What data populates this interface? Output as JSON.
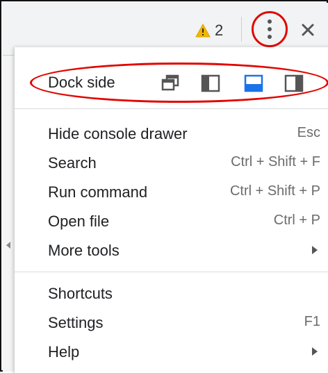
{
  "toolbar": {
    "warning_count": "2",
    "warning_icon": "warning-triangle-icon",
    "more_icon": "kebab-vertical-icon",
    "close_icon": "close-x-icon"
  },
  "dock": {
    "label": "Dock side",
    "options": [
      {
        "name": "undock",
        "icon": "undock-window-icon",
        "selected": false
      },
      {
        "name": "dock-left",
        "icon": "dock-left-icon",
        "selected": false
      },
      {
        "name": "dock-bottom",
        "icon": "dock-bottom-icon",
        "selected": true
      },
      {
        "name": "dock-right",
        "icon": "dock-right-icon",
        "selected": false
      }
    ]
  },
  "menu": {
    "hide_console_drawer": {
      "label": "Hide console drawer",
      "shortcut": "Esc"
    },
    "search": {
      "label": "Search",
      "shortcut": "Ctrl + Shift + F"
    },
    "run_command": {
      "label": "Run command",
      "shortcut": "Ctrl + Shift + P"
    },
    "open_file": {
      "label": "Open file",
      "shortcut": "Ctrl + P"
    },
    "more_tools": {
      "label": "More tools"
    },
    "shortcuts": {
      "label": "Shortcuts"
    },
    "settings": {
      "label": "Settings",
      "shortcut": "F1"
    },
    "help": {
      "label": "Help"
    }
  },
  "colors": {
    "accent": "#1a73e8",
    "annotation_red": "#e10600",
    "warning": "#f2b600"
  }
}
